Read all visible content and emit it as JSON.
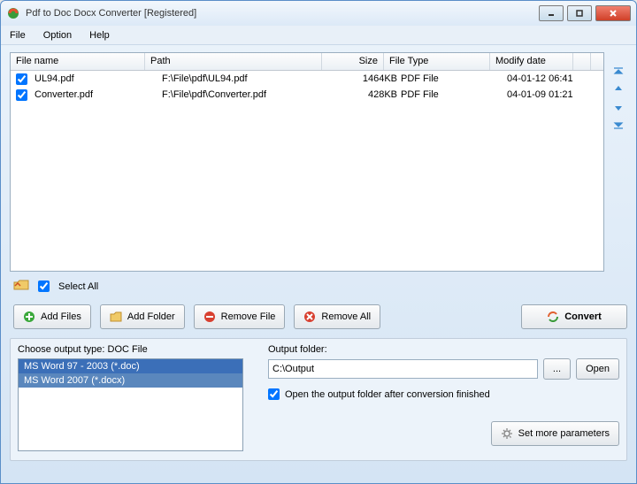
{
  "window": {
    "title": "Pdf to Doc Docx Converter [Registered]"
  },
  "menu": {
    "file": "File",
    "option": "Option",
    "help": "Help"
  },
  "columns": {
    "filename": "File name",
    "path": "Path",
    "size": "Size",
    "filetype": "File Type",
    "modify": "Modify date"
  },
  "rows": [
    {
      "checked": true,
      "name": "UL94.pdf",
      "path": "F:\\File\\pdf\\UL94.pdf",
      "size": "1464KB",
      "type": "PDF File",
      "date": "04-01-12 06:41"
    },
    {
      "checked": true,
      "name": "Converter.pdf",
      "path": "F:\\File\\pdf\\Converter.pdf",
      "size": "428KB",
      "type": "PDF File",
      "date": "04-01-09 01:21"
    }
  ],
  "selectall": {
    "label": "Select All",
    "checked": true
  },
  "buttons": {
    "add_files": "Add Files",
    "add_folder": "Add Folder",
    "remove_file": "Remove File",
    "remove_all": "Remove All",
    "convert": "Convert"
  },
  "output": {
    "type_label": "Choose output type:  DOC File",
    "options": [
      "MS Word 97 - 2003 (*.doc)",
      "MS Word 2007 (*.docx)"
    ],
    "folder_label": "Output folder:",
    "folder_value": "C:\\Output",
    "browse": "...",
    "open": "Open",
    "open_after_checked": true,
    "open_after_label": "Open the output folder after conversion finished",
    "more_params": "Set more parameters"
  }
}
